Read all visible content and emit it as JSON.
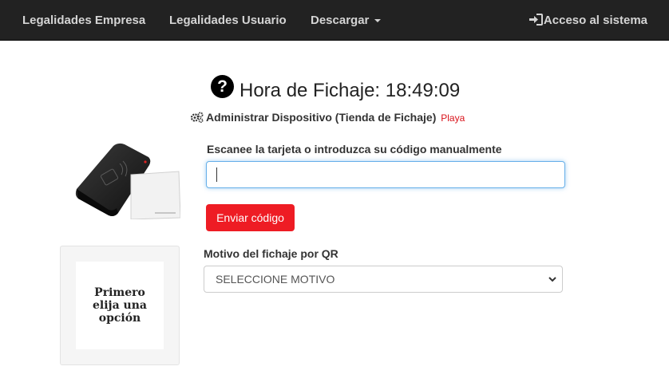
{
  "navbar": {
    "items": [
      {
        "label": "Legalidades Empresa"
      },
      {
        "label": "Legalidades Usuario"
      },
      {
        "label": "Descargar"
      }
    ],
    "login_label": "Acceso al sistema"
  },
  "header": {
    "title_label": "Hora de Fichaje:",
    "time": "18:49:09",
    "device_label": "Administrar Dispositivo (Tienda de Fichaje)",
    "store_name": "Playa"
  },
  "form": {
    "scan_label": "Escanee la tarjeta o introduzca su código manualmente",
    "scan_value": "",
    "send_button": "Enviar código",
    "motivo_label": "Motivo del fichaje por QR",
    "motivo_selected": "SELECCIONE MOTIVO"
  },
  "qr": {
    "placeholder_text": "Primero elija una opción"
  },
  "colors": {
    "navbar_bg": "#222222",
    "navbar_text": "#d4d4d4",
    "accent_red": "#ee1c24",
    "store_red": "#d9121a",
    "focus_blue": "#66afe9"
  },
  "icons": {
    "help": "question-circle-icon",
    "login": "sign-in-icon",
    "device": "gears-icon",
    "select": "chevron-down-icon"
  }
}
